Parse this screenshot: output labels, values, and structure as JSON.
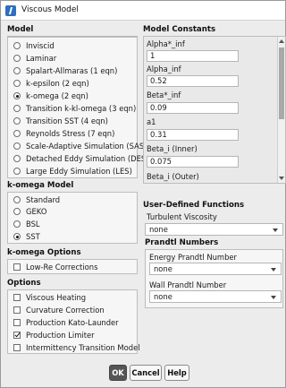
{
  "window": {
    "title": "Viscous Model"
  },
  "model": {
    "header": "Model",
    "options": [
      {
        "label": "Inviscid",
        "selected": false
      },
      {
        "label": "Laminar",
        "selected": false
      },
      {
        "label": "Spalart-Allmaras (1 eqn)",
        "selected": false
      },
      {
        "label": "k-epsilon (2 eqn)",
        "selected": false
      },
      {
        "label": "k-omega (2 eqn)",
        "selected": true
      },
      {
        "label": "Transition k-kl-omega (3 eqn)",
        "selected": false
      },
      {
        "label": "Transition SST (4 eqn)",
        "selected": false
      },
      {
        "label": "Reynolds Stress (7 eqn)",
        "selected": false
      },
      {
        "label": "Scale-Adaptive Simulation (SAS)",
        "selected": false
      },
      {
        "label": "Detached Eddy Simulation (DES)",
        "selected": false
      },
      {
        "label": "Large Eddy Simulation (LES)",
        "selected": false
      }
    ]
  },
  "kOmegaModel": {
    "header": "k-omega Model",
    "options": [
      {
        "label": "Standard",
        "selected": false
      },
      {
        "label": "GEKO",
        "selected": false
      },
      {
        "label": "BSL",
        "selected": false
      },
      {
        "label": "SST",
        "selected": true
      }
    ]
  },
  "kOmegaOptions": {
    "header": "k-omega Options",
    "items": [
      {
        "label": "Low-Re Corrections",
        "checked": false
      }
    ]
  },
  "options": {
    "header": "Options",
    "items": [
      {
        "label": "Viscous Heating",
        "checked": false
      },
      {
        "label": "Curvature Correction",
        "checked": false
      },
      {
        "label": "Production Kato-Launder",
        "checked": false
      },
      {
        "label": "Production Limiter",
        "checked": true
      },
      {
        "label": "Intermittency Transition Model",
        "checked": false
      }
    ]
  },
  "modelConstants": {
    "header": "Model Constants",
    "items": [
      {
        "label": "Alpha*_inf",
        "value": "1"
      },
      {
        "label": "Alpha_inf",
        "value": "0.52"
      },
      {
        "label": "Beta*_inf",
        "value": "0.09"
      },
      {
        "label": "a1",
        "value": "0.31"
      },
      {
        "label": "Beta_i (Inner)",
        "value": "0.075"
      },
      {
        "label": "Beta_i (Outer)",
        "value": ""
      }
    ]
  },
  "userDefined": {
    "header": "User-Defined Functions",
    "turbulentViscosity": {
      "label": "Turbulent Viscosity",
      "value": "none"
    }
  },
  "prandtl": {
    "header": "Prandtl Numbers",
    "energy": {
      "label": "Energy Prandtl Number",
      "value": "none"
    },
    "wall": {
      "label": "Wall Prandtl Number",
      "value": "none"
    }
  },
  "buttons": {
    "ok": "OK",
    "cancel": "Cancel",
    "help": "Help"
  },
  "colors": {
    "accent": "#2f6fbf",
    "okButton": "#555555"
  }
}
